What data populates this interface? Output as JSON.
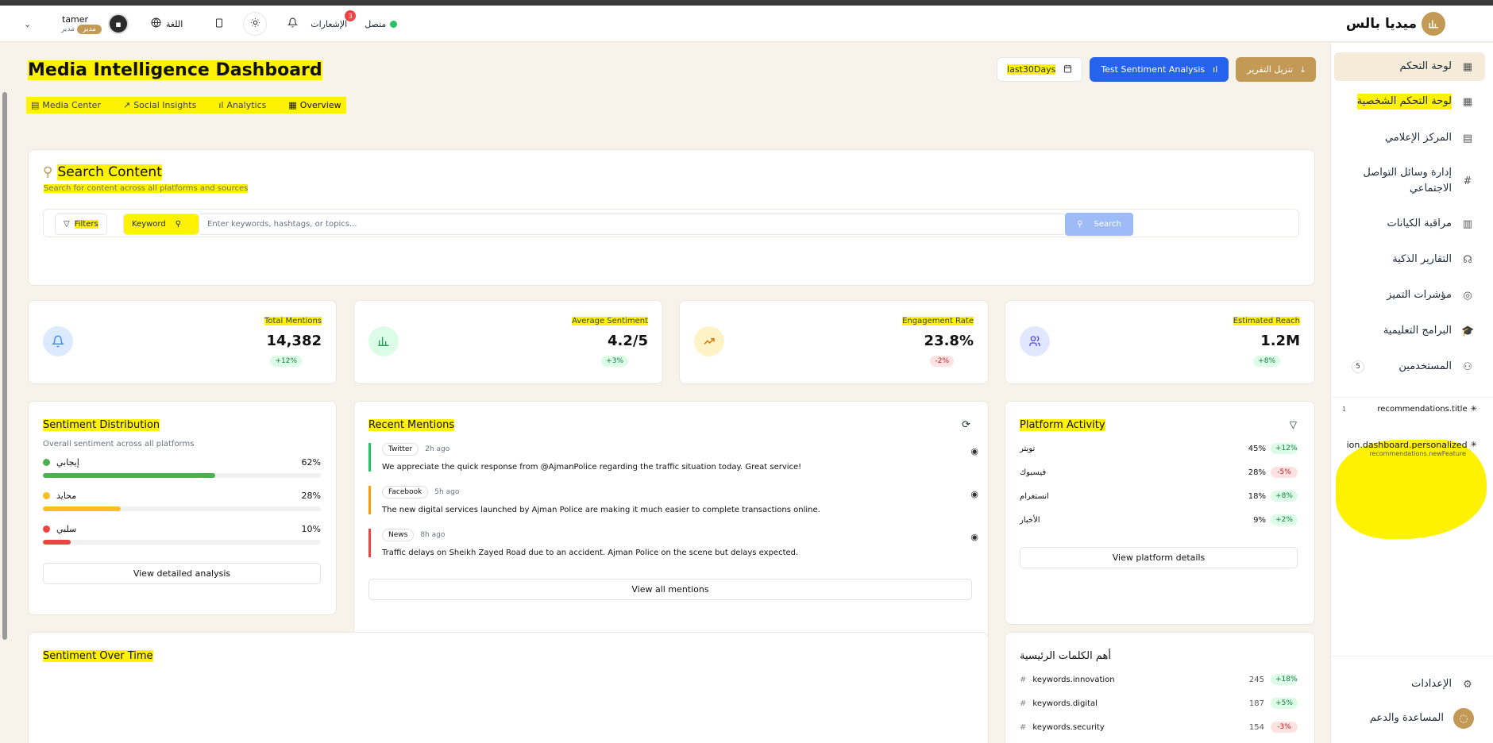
{
  "header": {
    "user_name": "tamer",
    "user_role_badge": "مدير",
    "user_role": "مدير",
    "language_label": "اللغة",
    "notifications_label": "الإشعارات",
    "notifications_count": "3",
    "status_label": "متصل",
    "brand_name": "ميديا بالس"
  },
  "sidebar": {
    "items": [
      {
        "label": "لوحة التحكم",
        "icon": "grid-icon",
        "active": true
      },
      {
        "label": "لوحة التحكم الشخصية",
        "icon": "grid-icon"
      },
      {
        "label": "المركز الإعلامي",
        "icon": "film-icon"
      },
      {
        "label": "إدارة وسائل التواصل الاجتماعي",
        "icon": "hash-icon"
      },
      {
        "label": "مراقبة الكيانات",
        "icon": "building-icon"
      },
      {
        "label": "التقارير الذكية",
        "icon": "brain-icon"
      },
      {
        "label": "مؤشرات التميز",
        "icon": "target-icon"
      },
      {
        "label": "البرامج التعليمية",
        "icon": "graduation-icon"
      },
      {
        "label": "المستخدمين",
        "icon": "users-icon",
        "count": "5"
      }
    ],
    "recommendations": {
      "count": "1",
      "title": "recommendations.title",
      "item_title": "ion.dashboard.personalized",
      "item_sub": "recommendations.newFeature"
    },
    "settings_label": "الإعدادات",
    "help_label": "المساعدة والدعم"
  },
  "page": {
    "title": "Media Intelligence Dashboard",
    "tabs": [
      "Media Center",
      "Social Insights",
      "Analytics",
      "Overview"
    ],
    "actions": {
      "download": "تنزيل التقرير",
      "test_sentiment": "Test Sentiment Analysis",
      "date_range": "last30Days"
    }
  },
  "search": {
    "title": "Search Content",
    "subtitle": "Search for content across all platforms and sources",
    "filters_label": "Filters",
    "mode_label": "Keyword",
    "placeholder": "Enter keywords, hashtags, or topics...",
    "button_label": "Search"
  },
  "stats": [
    {
      "label": "Total Mentions",
      "value": "14,382",
      "delta": "+12%",
      "trend": "up",
      "icon": "bell-icon",
      "color": "#dbeafe"
    },
    {
      "label": "Average Sentiment",
      "value": "4.2/5",
      "delta": "+3%",
      "trend": "up",
      "icon": "bar-chart-icon",
      "color": "#dcfce7"
    },
    {
      "label": "Engagement Rate",
      "value": "23.8%",
      "delta": "-2%",
      "trend": "down",
      "icon": "trending-up-icon",
      "color": "#fef3c7"
    },
    {
      "label": "Estimated Reach",
      "value": "1.2M",
      "delta": "+8%",
      "trend": "up",
      "icon": "users-icon",
      "color": "#e0e7ff"
    }
  ],
  "sentiment": {
    "title": "Sentiment Distribution",
    "subtitle": "Overall sentiment across all platforms",
    "rows": [
      {
        "label": "إيجابي",
        "pct": "62%",
        "value": 0.62,
        "color": "#4caf50"
      },
      {
        "label": "محايد",
        "pct": "28%",
        "value": 0.28,
        "color": "#fbbf24"
      },
      {
        "label": "سلبي",
        "pct": "10%",
        "value": 0.1,
        "color": "#ef4444"
      }
    ],
    "button": "View detailed analysis"
  },
  "mentions": {
    "title": "Recent Mentions",
    "items": [
      {
        "source": "Twitter",
        "time": "2h ago",
        "text": "We appreciate the quick response from @AjmanPolice regarding the traffic situation today. Great service!",
        "color": "#22c55e"
      },
      {
        "source": "Facebook",
        "time": "5h ago",
        "text": "The new digital services launched by Ajman Police are making it much easier to complete transactions online.",
        "color": "#f59e0b"
      },
      {
        "source": "News",
        "time": "8h ago",
        "text": "Traffic delays on Sheikh Zayed Road due to an accident. Ajman Police on the scene but delays expected.",
        "color": "#ef4444"
      }
    ],
    "button": "View all mentions"
  },
  "platforms": {
    "title": "Platform Activity",
    "rows": [
      {
        "name": "تويتر",
        "pct": "45%",
        "delta": "+12%",
        "trend": "up"
      },
      {
        "name": "فيسبوك",
        "pct": "28%",
        "delta": "-5%",
        "trend": "down"
      },
      {
        "name": "انستغرام",
        "pct": "18%",
        "delta": "+8%",
        "trend": "up"
      },
      {
        "name": "الأخبار",
        "pct": "9%",
        "delta": "+2%",
        "trend": "up"
      }
    ],
    "button": "View platform details"
  },
  "sentiment_time": {
    "title": "Sentiment Over Time"
  },
  "keywords": {
    "title": "أهم الكلمات الرئيسية",
    "rows": [
      {
        "name": "keywords.innovation",
        "count": "245",
        "delta": "+18%",
        "trend": "up"
      },
      {
        "name": "keywords.digital",
        "count": "187",
        "delta": "+5%",
        "trend": "up"
      },
      {
        "name": "keywords.security",
        "count": "154",
        "delta": "-3%",
        "trend": "down"
      }
    ]
  }
}
